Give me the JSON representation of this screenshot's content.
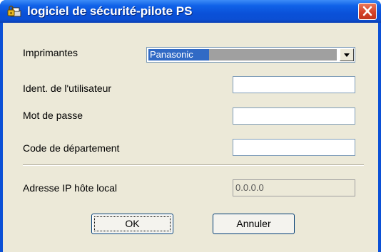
{
  "window": {
    "title": "logiciel de sécurité-pilote PS",
    "app_icon": "lock-printer-icon",
    "close_icon": "close-icon"
  },
  "form": {
    "printers_label": "Imprimantes",
    "printers_selected": "Panasonic",
    "user_id_label": "Ident. de l'utilisateur",
    "user_id_value": "",
    "password_label": "Mot de passe",
    "password_value": "",
    "department_label": "Code de département",
    "department_value": "",
    "local_ip_label": "Adresse IP hôte local",
    "local_ip_value": "0.0.0.0"
  },
  "buttons": {
    "ok": "OK",
    "cancel": "Annuler"
  },
  "colors": {
    "titlebar": "#0b50d6",
    "dialog_bg": "#ece9d8",
    "selection": "#316ac5",
    "close": "#d5432a"
  }
}
